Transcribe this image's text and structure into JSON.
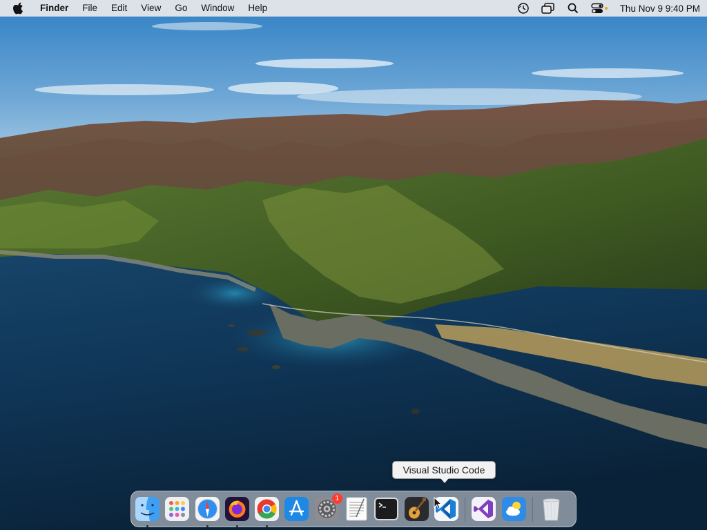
{
  "menubar": {
    "app_name": "Finder",
    "menus": [
      "File",
      "Edit",
      "View",
      "Go",
      "Window",
      "Help"
    ],
    "status_icons": [
      "time-machine-icon",
      "screen-mirroring-icon",
      "search-icon",
      "control-center-icon"
    ],
    "clock": "Thu Nov 9  9:40 PM"
  },
  "tooltip": {
    "text": "Visual Studio Code"
  },
  "dock": {
    "apps": [
      {
        "name": "Finder",
        "running": true
      },
      {
        "name": "Launchpad",
        "running": false
      },
      {
        "name": "Safari",
        "running": true
      },
      {
        "name": "Firefox",
        "running": true
      },
      {
        "name": "Google Chrome",
        "running": true
      },
      {
        "name": "App Store",
        "running": false
      },
      {
        "name": "System Preferences",
        "running": false,
        "badge": "1"
      },
      {
        "name": "TextEdit",
        "running": false
      },
      {
        "name": "Terminal",
        "running": false
      },
      {
        "name": "GarageBand",
        "running": false
      },
      {
        "name": "Visual Studio Code",
        "running": false
      }
    ],
    "recent_apps": [
      {
        "name": "Visual Studio",
        "running": false
      },
      {
        "name": "Weather",
        "running": false
      }
    ],
    "trash": {
      "name": "Trash"
    }
  },
  "colors": {
    "menubar_bg": "#eaeaea",
    "accent_blue": "#1e88e5",
    "badge_red": "#ff3b30"
  }
}
